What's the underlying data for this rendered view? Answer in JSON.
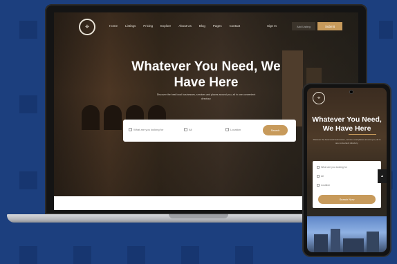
{
  "site": {
    "logo_icon": "map-pin-icon",
    "nav_items": [
      "Home",
      "Listings",
      "Pricing",
      "Explore",
      "About Us",
      "Blog",
      "Pages",
      "Contact"
    ],
    "sign_in": "Sign In",
    "login_label": "Add Listing",
    "cta_label": "Submit"
  },
  "hero": {
    "title": "Whatever You Need, We Have Here",
    "subtitle": "Discover the best local businesses, services and places around you, all in one convenient directory."
  },
  "search": {
    "field_keyword": "What are you looking for",
    "field_category": "All",
    "field_location": "Location",
    "button": "Search"
  },
  "phone": {
    "title": "Whatever You Need, We Have Here",
    "subtitle": "Discover the best local businesses, services and places around you, all in one convenient directory.",
    "field_keyword": "What are you looking for",
    "field_category": "All",
    "field_location": "Location",
    "button": "Search Now",
    "side_icon": "chevron-up-icon"
  },
  "colors": {
    "background": "#1c3f7e",
    "accent": "#c79a5b"
  }
}
